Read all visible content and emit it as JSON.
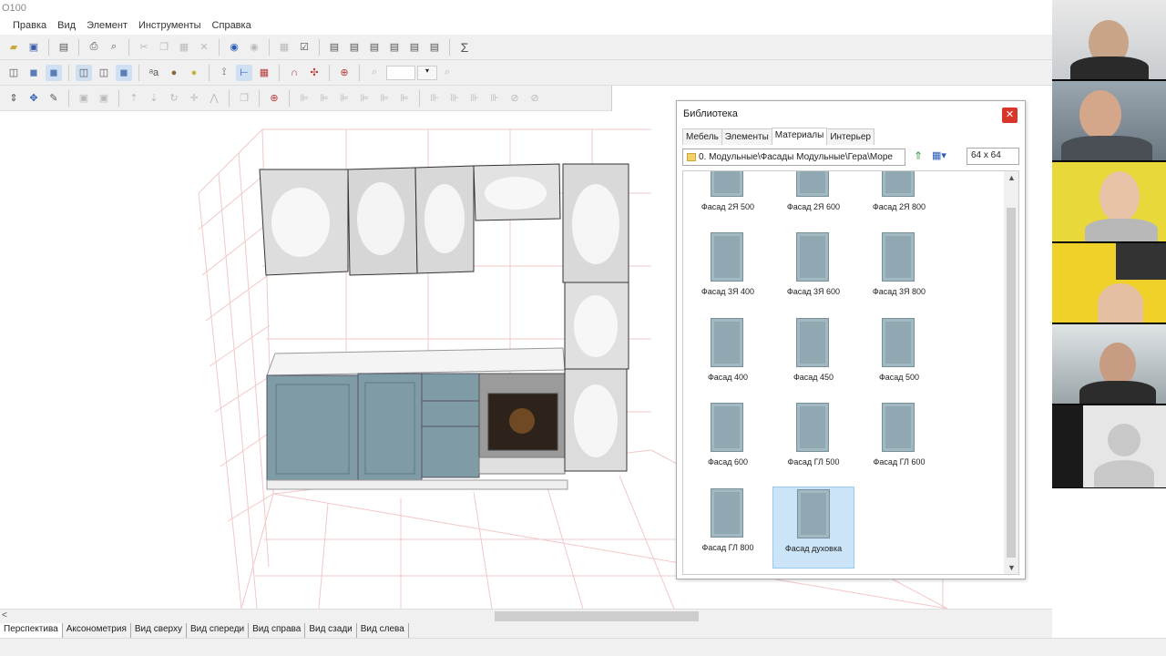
{
  "window": {
    "title": "O100"
  },
  "menu": [
    "Правка",
    "Вид",
    "Элемент",
    "Инструменты",
    "Справка"
  ],
  "view_tabs": [
    "Перспектива",
    "Аксонометрия",
    "Вид сверху",
    "Вид спереди",
    "Вид справа",
    "Вид сзади",
    "Вид слева"
  ],
  "library": {
    "title": "Библиотека",
    "close_icon": "close-icon",
    "tabs": [
      "Мебель",
      "Элементы",
      "Материалы",
      "Интерьер"
    ],
    "active_tab": "Материалы",
    "path": "0. Модульные\\Фасады Модульные\\Гера\\Море",
    "size": "64 x 64",
    "items": [
      {
        "label": "Фасад 2Я 500"
      },
      {
        "label": "Фасад 2Я 600"
      },
      {
        "label": "Фасад 2Я 800"
      },
      {
        "label": "Фасад 3Я 400"
      },
      {
        "label": "Фасад 3Я 600"
      },
      {
        "label": "Фасад 3Я 800"
      },
      {
        "label": "Фасад 400"
      },
      {
        "label": "Фасад 450"
      },
      {
        "label": "Фасад 500"
      },
      {
        "label": "Фасад 600"
      },
      {
        "label": "Фасад ГЛ 500"
      },
      {
        "label": "Фасад ГЛ 600"
      },
      {
        "label": "Фасад ГЛ 800"
      },
      {
        "label": "Фасад духовка"
      }
    ],
    "selected_item": "Фасад духовка",
    "swatch_color": "#8fa8b2"
  },
  "colors": {
    "selection": "#cce4f7",
    "close_button": "#d9362b"
  }
}
